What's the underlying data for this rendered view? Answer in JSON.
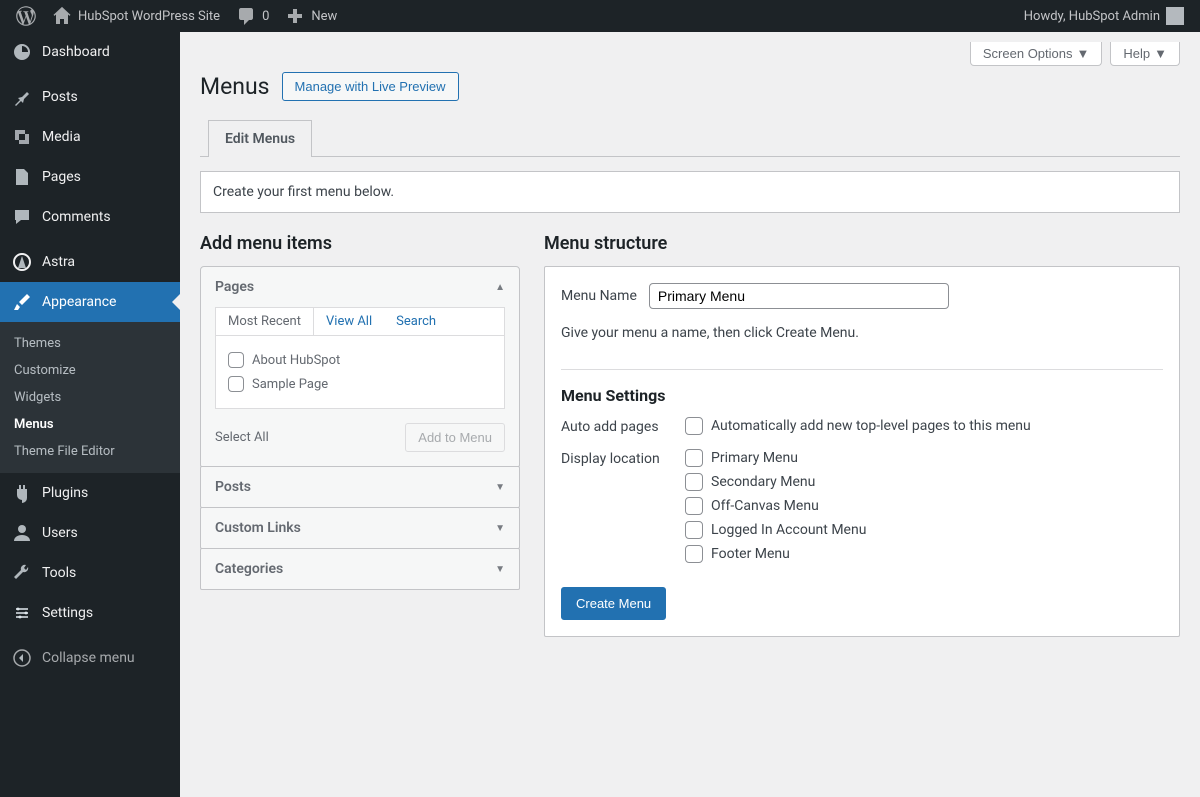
{
  "adminbar": {
    "site_title": "HubSpot WordPress Site",
    "comments_count": "0",
    "new_label": "New",
    "howdy": "Howdy, HubSpot Admin"
  },
  "sidebar": {
    "items": [
      {
        "label": "Dashboard"
      },
      {
        "label": "Posts"
      },
      {
        "label": "Media"
      },
      {
        "label": "Pages"
      },
      {
        "label": "Comments"
      },
      {
        "label": "Astra"
      },
      {
        "label": "Appearance"
      },
      {
        "label": "Plugins"
      },
      {
        "label": "Users"
      },
      {
        "label": "Tools"
      },
      {
        "label": "Settings"
      }
    ],
    "submenu": {
      "themes": "Themes",
      "customize": "Customize",
      "widgets": "Widgets",
      "menus": "Menus",
      "theme_file_editor": "Theme File Editor"
    },
    "collapse_label": "Collapse menu"
  },
  "screen": {
    "options": "Screen Options",
    "help": "Help"
  },
  "heading": {
    "title": "Menus",
    "live_preview": "Manage with Live Preview"
  },
  "tabs": {
    "edit_menus": "Edit Menus"
  },
  "notice": "Create your first menu below.",
  "add_items": {
    "heading": "Add menu items",
    "acc": {
      "pages": "Pages",
      "posts": "Posts",
      "custom_links": "Custom Links",
      "categories": "Categories"
    },
    "inner_tabs": {
      "most_recent": "Most Recent",
      "view_all": "View All",
      "search": "Search"
    },
    "page_items": [
      "About HubSpot",
      "Sample Page"
    ],
    "select_all": "Select All",
    "add_to_menu": "Add to Menu"
  },
  "structure": {
    "heading": "Menu structure",
    "menu_name_label": "Menu Name",
    "menu_name_value": "Primary Menu",
    "helper": "Give your menu a name, then click Create Menu.",
    "settings_heading": "Menu Settings",
    "auto_add_label": "Auto add pages",
    "auto_add_option": "Automatically add new top-level pages to this menu",
    "display_location_label": "Display location",
    "locations": [
      "Primary Menu",
      "Secondary Menu",
      "Off-Canvas Menu",
      "Logged In Account Menu",
      "Footer Menu"
    ],
    "create_button": "Create Menu"
  }
}
